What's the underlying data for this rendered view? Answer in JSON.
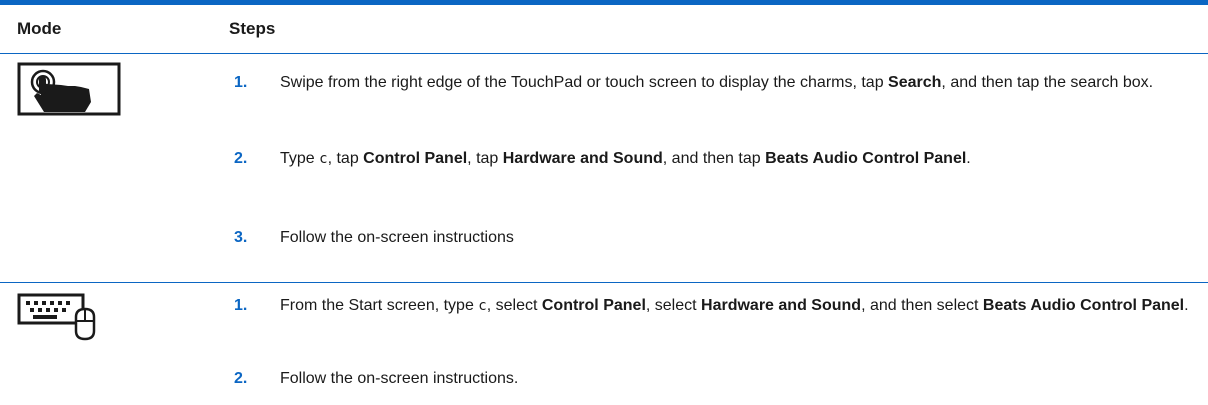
{
  "header": {
    "mode": "Mode",
    "steps": "Steps"
  },
  "rows": [
    {
      "icon": "touch-gesture-icon",
      "steps": [
        {
          "num": "1.",
          "t1": "Swipe from the right edge of the TouchPad or touch screen to display the charms, tap ",
          "b1": "Search",
          "t2": ", and then tap the search box."
        },
        {
          "num": "2.",
          "t1": "Type ",
          "code": "c",
          "t2": ", tap ",
          "b1": "Control Panel",
          "t3": ", tap ",
          "b2": "Hardware and Sound",
          "t4": ", and then tap ",
          "b3": "Beats Audio Control Panel",
          "t5": "."
        },
        {
          "num": "3.",
          "t1": "Follow the on-screen instructions"
        }
      ]
    },
    {
      "icon": "keyboard-mouse-icon",
      "steps": [
        {
          "num": "1.",
          "t1": "From the Start screen, type ",
          "code": "c",
          "t2": ", select ",
          "b1": "Control Panel",
          "t3": ", select ",
          "b2": "Hardware and Sound",
          "t4": ", and then select ",
          "b3": "Beats Audio Control Panel",
          "t5": "."
        },
        {
          "num": "2.",
          "t1": "Follow the on-screen instructions."
        }
      ]
    }
  ],
  "colors": {
    "accent": "#0b66c3",
    "text": "#1a1a1a"
  }
}
